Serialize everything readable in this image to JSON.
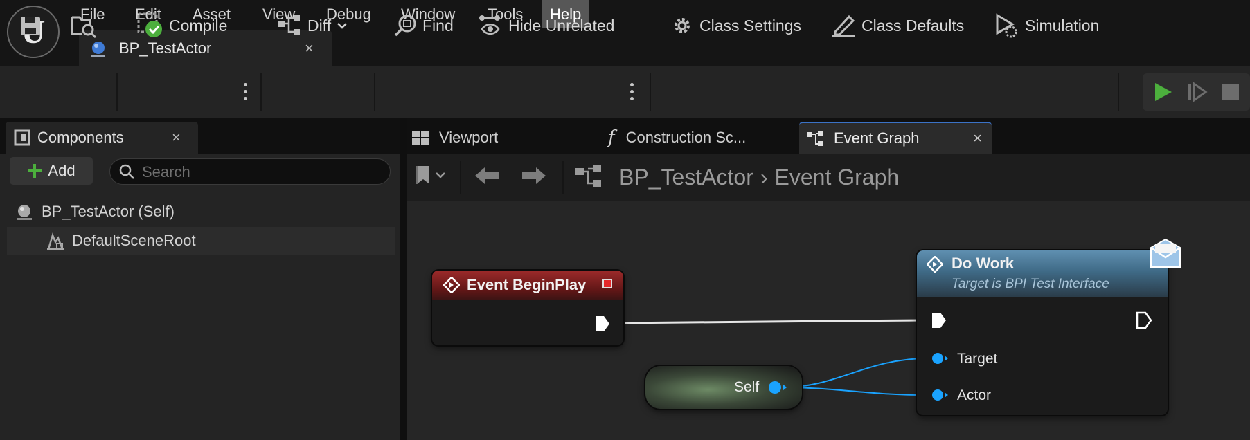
{
  "app": {
    "logo_glyph": "U"
  },
  "menu": {
    "items": [
      "File",
      "Edit",
      "Asset",
      "View",
      "Debug",
      "Window",
      "Tools",
      "Help"
    ],
    "active": "Help"
  },
  "document_tab": {
    "label": "BP_TestActor",
    "close_glyph": "×"
  },
  "toolbar": {
    "compile_label": "Compile",
    "diff_label": "Diff",
    "find_label": "Find",
    "hide_unrelated_label": "Hide Unrelated",
    "class_settings_label": "Class Settings",
    "class_defaults_label": "Class Defaults",
    "simulation_label": "Simulation"
  },
  "components_panel": {
    "tab_label": "Components",
    "close_glyph": "×",
    "add_label": "Add",
    "search_placeholder": "Search",
    "tree": [
      {
        "label": "BP_TestActor (Self)",
        "icon": "actor-sphere-icon"
      },
      {
        "label": "DefaultSceneRoot",
        "icon": "scene-root-icon"
      }
    ]
  },
  "graph_tabs": {
    "viewport": "Viewport",
    "construction": "Construction Sc...",
    "construction_icon_glyph": "f",
    "event_graph": "Event Graph",
    "close_glyph": "×"
  },
  "breadcrumb": {
    "root": "BP_TestActor",
    "separator": "›",
    "current": "Event Graph"
  },
  "nodes": {
    "begin_play": {
      "title": "Event BeginPlay"
    },
    "do_work": {
      "title": "Do Work",
      "subtitle": "Target is BPI Test Interface",
      "pins": [
        "Target",
        "Actor"
      ]
    },
    "self": {
      "label": "Self"
    }
  },
  "colors": {
    "accent_blue": "#3b72c6",
    "compile_ok_green": "#4caf3d",
    "play_green": "#4caf3d",
    "object_pin_blue": "#1aa3ff",
    "event_header_red": "#9c2a2a",
    "function_header_blue": "#5f8fb0"
  }
}
